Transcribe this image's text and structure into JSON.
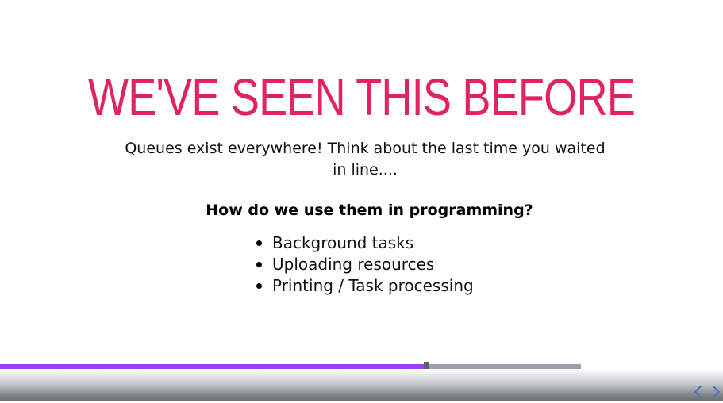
{
  "slide": {
    "title": "WE'VE SEEN THIS BEFORE",
    "intro": "Queues exist everywhere! Think about the last time you waited in line....",
    "question": "How do we use them in programming?",
    "bullets": [
      "Background tasks",
      "Uploading resources",
      "Printing / Task processing"
    ]
  },
  "player": {
    "progress_fraction": 0.733,
    "nav_prev_icon": "chevron-left-icon",
    "nav_next_icon": "chevron-right-icon"
  },
  "colors": {
    "title": "#e0245e",
    "progress_fill": "#9b3ef0",
    "progress_track": "#9aa0ad",
    "nav_icon": "#4a78b8"
  }
}
